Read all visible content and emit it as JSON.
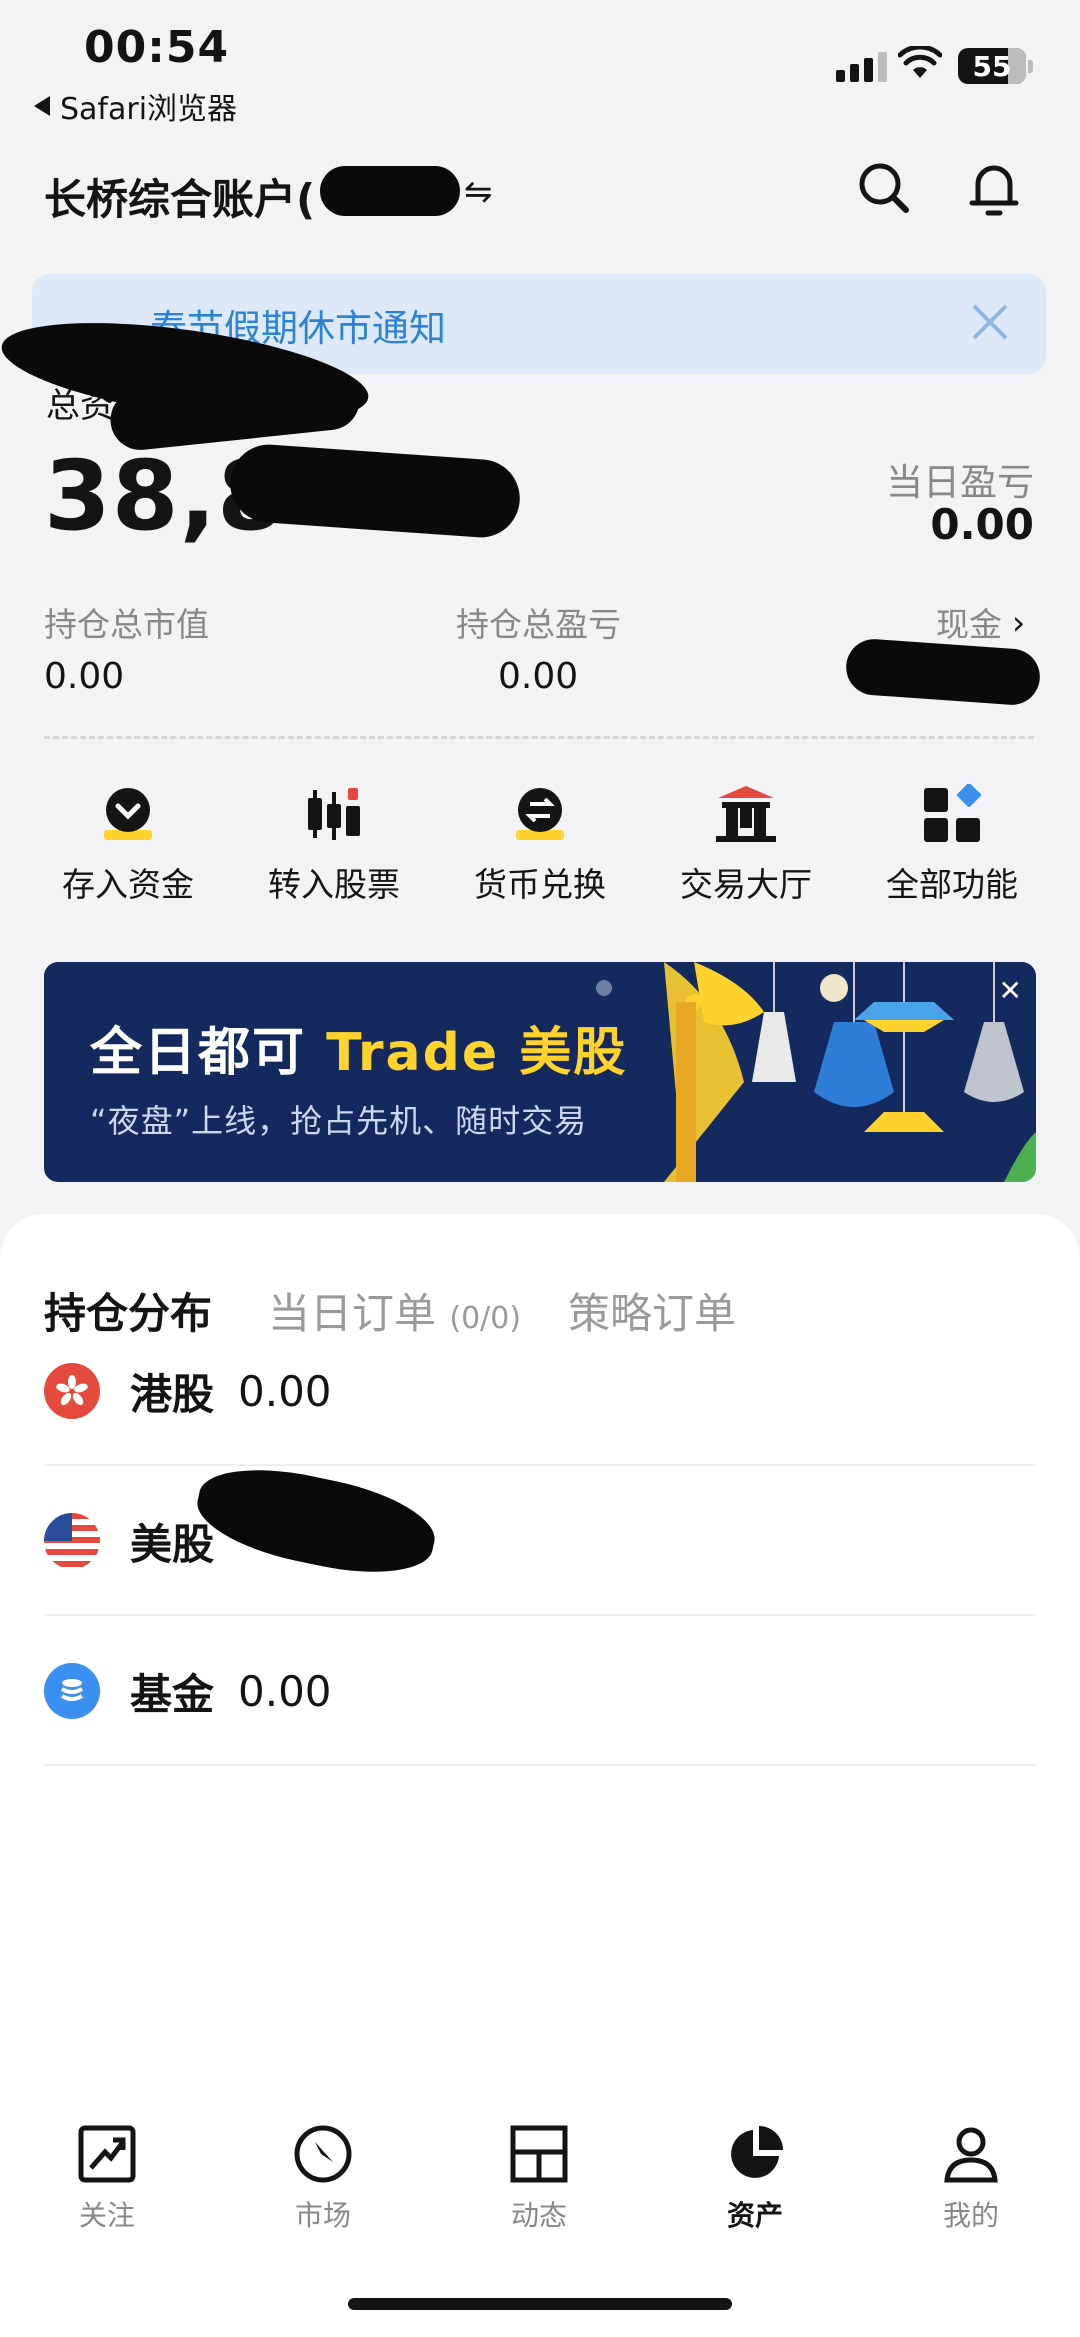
{
  "status_bar": {
    "time": "00:54",
    "back_app": "Safari浏览器",
    "battery": "55"
  },
  "header": {
    "account_name": "长桥综合账户(",
    "switch_glyph": "⇋"
  },
  "notice": {
    "text": "春节假期休市通知"
  },
  "assets": {
    "total_label": "总资",
    "total_value": "38,8",
    "day_pnl_label": "当日盈亏",
    "day_pnl_value": "0.00",
    "stats": [
      {
        "label": "持仓总市值",
        "value": "0.00"
      },
      {
        "label": "持仓总盈亏",
        "value": "0.00"
      },
      {
        "label": "现金",
        "value": ""
      }
    ]
  },
  "quick_actions": [
    {
      "label": "存入资金",
      "icon": "deposit-icon"
    },
    {
      "label": "转入股票",
      "icon": "candlestick-icon"
    },
    {
      "label": "货币兑换",
      "icon": "exchange-icon"
    },
    {
      "label": "交易大厅",
      "icon": "hall-icon"
    },
    {
      "label": "全部功能",
      "icon": "grid-icon"
    }
  ],
  "banner": {
    "title_white": "全日都可 ",
    "title_yellow": "Trade 美股",
    "subtitle": "“夜盘”上线，抢占先机、随时交易"
  },
  "tabs": {
    "holdings": "持仓分布",
    "today_orders": "当日订单",
    "today_orders_count": "(0/0)",
    "strategy_orders": "策略订单"
  },
  "holdings": [
    {
      "name": "港股",
      "value": "0.00",
      "icon": "hk-flag-icon"
    },
    {
      "name": "美股",
      "value": "",
      "icon": "us-flag-icon"
    },
    {
      "name": "基金",
      "value": "0.00",
      "icon": "fund-icon"
    }
  ],
  "nav": [
    {
      "label": "关注",
      "icon": "watchlist-icon"
    },
    {
      "label": "市场",
      "icon": "compass-icon"
    },
    {
      "label": "动态",
      "icon": "feed-icon"
    },
    {
      "label": "资产",
      "icon": "pie-chart-icon"
    },
    {
      "label": "我的",
      "icon": "profile-icon"
    }
  ],
  "colors": {
    "accent_blue": "#2c83d6",
    "banner_bg": "#142a5e",
    "banner_yellow": "#ffd22e",
    "hk_red": "#e5483c",
    "fund_blue": "#3a8ff0",
    "notice_bg": "#dde9f8"
  }
}
